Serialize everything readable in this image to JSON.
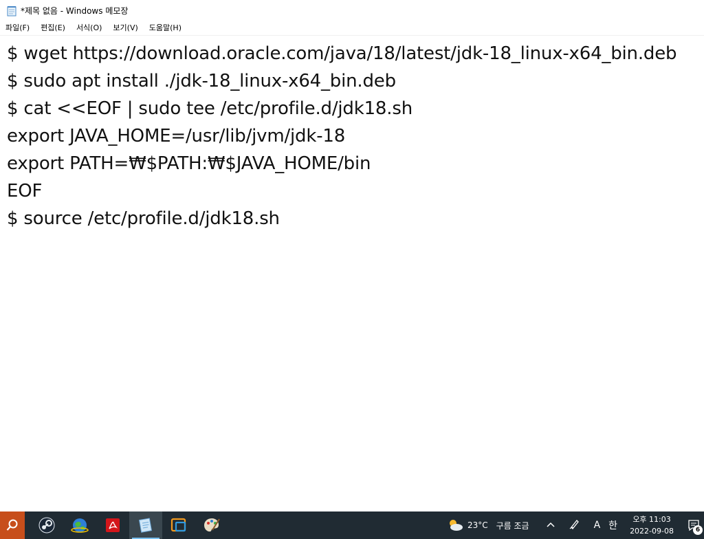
{
  "window": {
    "title": "*제목 없음 - Windows 메모장",
    "icon": "notepad-icon"
  },
  "menu": [
    {
      "label": "파일(F)"
    },
    {
      "label": "편집(E)"
    },
    {
      "label": "서식(O)"
    },
    {
      "label": "보기(V)"
    },
    {
      "label": "도움말(H)"
    }
  ],
  "editor": {
    "content": "$ wget https://download.oracle.com/java/18/latest/jdk-18_linux-x64_bin.deb\n$ sudo apt install ./jdk-18_linux-x64_bin.deb\n$ cat <<EOF | sudo tee /etc/profile.d/jdk18.sh\nexport JAVA_HOME=/usr/lib/jvm/jdk-18\nexport PATH=₩$PATH:₩$JAVA_HOME/bin\nEOF\n$ source /etc/profile.d/jdk18.sh"
  },
  "taskbar": {
    "apps": [
      {
        "name": "search",
        "icon": "search-icon"
      },
      {
        "name": "steam",
        "icon": "steam-icon"
      },
      {
        "name": "network",
        "icon": "globe-icon"
      },
      {
        "name": "acrobat",
        "icon": "pdf-icon"
      },
      {
        "name": "notepad",
        "icon": "notepad-icon",
        "active": true
      },
      {
        "name": "window",
        "icon": "window-icon"
      },
      {
        "name": "paint",
        "icon": "palette-icon"
      }
    ]
  },
  "tray": {
    "weather_temp": "23°C",
    "weather_desc": "구름 조금",
    "overflow": "^",
    "pen": "pen-icon",
    "ime_mode": "A",
    "ime_lang": "한",
    "time": "오후 11:03",
    "date": "2022-09-08",
    "notifications": "6"
  },
  "colors": {
    "taskbar_bg": "#202b33",
    "search_bg": "#c74e1b",
    "active_indicator": "#7ac1f0"
  }
}
